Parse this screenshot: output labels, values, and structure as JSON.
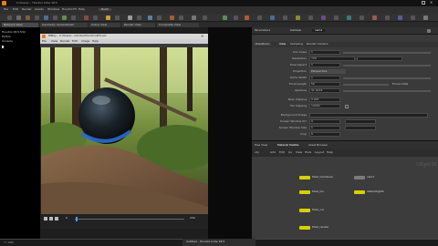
{
  "window": {
    "title": "C:/Users/... Houdini Indie 18.5"
  },
  "menu": {
    "items": [
      "File",
      "Edit",
      "Render",
      "Assets",
      "Windows",
      "Houdini FX",
      "Help"
    ],
    "build_label": "Build"
  },
  "tabs": {
    "items": [
      "Network View",
      "Geometry Spreadsheet",
      "Scene View",
      "Render View",
      "Composite View"
    ]
  },
  "console": {
    "lines": [
      "Houdini 18.5.532",
      "Python",
      "Console"
    ]
  },
  "render_view": {
    "title": "MPlay - C:/Users/.../render/Houdini.$F4.exr",
    "menu": [
      "File",
      "View",
      "Render",
      "Edit",
      "Image",
      "Help"
    ],
    "frame": "1",
    "end_frame": "240"
  },
  "parameters": {
    "panel_label": "Parameters",
    "node_label": "Camera",
    "node_name": "cam1",
    "tabs": [
      "Transform",
      "View",
      "Sampling",
      "Render Camera"
    ],
    "rows": [
      {
        "label": "Icon Scale",
        "value": "1"
      },
      {
        "label": "Resolution",
        "value": "720"
      },
      {
        "label": "Pixel Aspect",
        "value": "1"
      },
      {
        "label": "Projection",
        "value": "Perspective"
      },
      {
        "label": "Ortho Width",
        "value": "1"
      },
      {
        "label": "Focal Length",
        "value": "50"
      },
      {
        "label": "Aperture",
        "value": "41.4214"
      },
      {
        "label": "Near Clipping",
        "value": "0.001"
      },
      {
        "label": "Far Clipping",
        "value": "10000"
      },
      {
        "label": "Background Image",
        "value": ""
      },
      {
        "label": "Screen Window X/Y",
        "value": "0"
      },
      {
        "label": "Screen Window Size",
        "value": "1"
      },
      {
        "label": "Crop",
        "value": "0"
      }
    ],
    "focus_label": "Focus Units"
  },
  "network": {
    "tabs": [
      "Tree View",
      "Material Palette",
      "Asset Browser"
    ],
    "path_label": "obj",
    "menu": [
      "Add",
      "Edit",
      "Go",
      "View",
      "Tools",
      "Layout",
      "Help"
    ],
    "overlay_label": "Objects",
    "nodes": [
      {
        "name": "Pixel_Container",
        "color": "#d6d000"
      },
      {
        "name": "cam1",
        "color": "#7b7b7b"
      },
      {
        "name": "Pixel_lon",
        "color": "#d6d000"
      },
      {
        "name": "distantlight1",
        "color": "#d6d000"
      },
      {
        "name": "Pixel_col",
        "color": "#d6d000"
      },
      {
        "name": "Pixel_render",
        "color": "#d6d000"
      }
    ]
  },
  "bottom": {
    "left": "7 / 240",
    "center": "Untitled - Houdini Indie 18.5"
  }
}
